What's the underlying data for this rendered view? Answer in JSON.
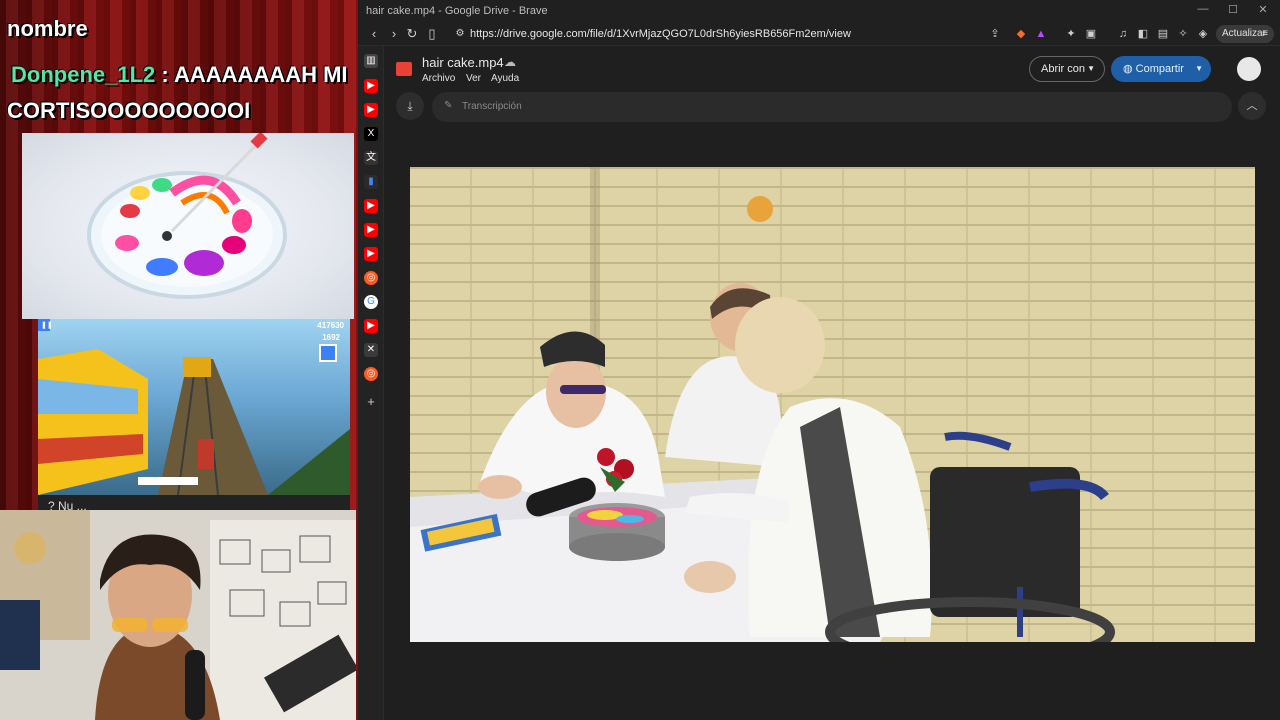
{
  "stream": {
    "chat_top_cut": "nombre",
    "chat_user": "Donpene_1L2",
    "chat_sep": " : ",
    "chat_message_1": "AAAAAAAAH MI",
    "chat_message_2": "CORTISOOOOOOOOOI",
    "game_score": "417630",
    "game_coins": "1692",
    "sub_text": "? Nu ... "
  },
  "browser": {
    "window_title": "hair cake.mp4 - Google Drive - Brave",
    "url": "https://drive.google.com/file/d/1XvrMjazQGO7L0drSh6yiesRB656Fm2em/view",
    "update_label": "Actualizar",
    "win_minimize": "—",
    "win_maximize": "☐",
    "win_close": "✕"
  },
  "viewer": {
    "file_name": "hair cake.mp4",
    "menu": [
      "Archivo",
      "Ver",
      "Ayuda"
    ],
    "open_with": "Abrir con",
    "share": "Compartir",
    "transcript": "Transcripción"
  },
  "colors": {
    "share_button": "#1f5fa8",
    "chat_username": "#55e6a5",
    "file_icon": "#e94235"
  },
  "icons": [
    "back-icon",
    "forward-icon",
    "reload-icon",
    "bookmark-icon",
    "site-settings-icon",
    "share-page-icon",
    "brave-shields-icon",
    "extensions-icon",
    "download-icon",
    "chevron-up-icon",
    "globe-icon",
    "dropdown-icon",
    "cloud-icon"
  ]
}
